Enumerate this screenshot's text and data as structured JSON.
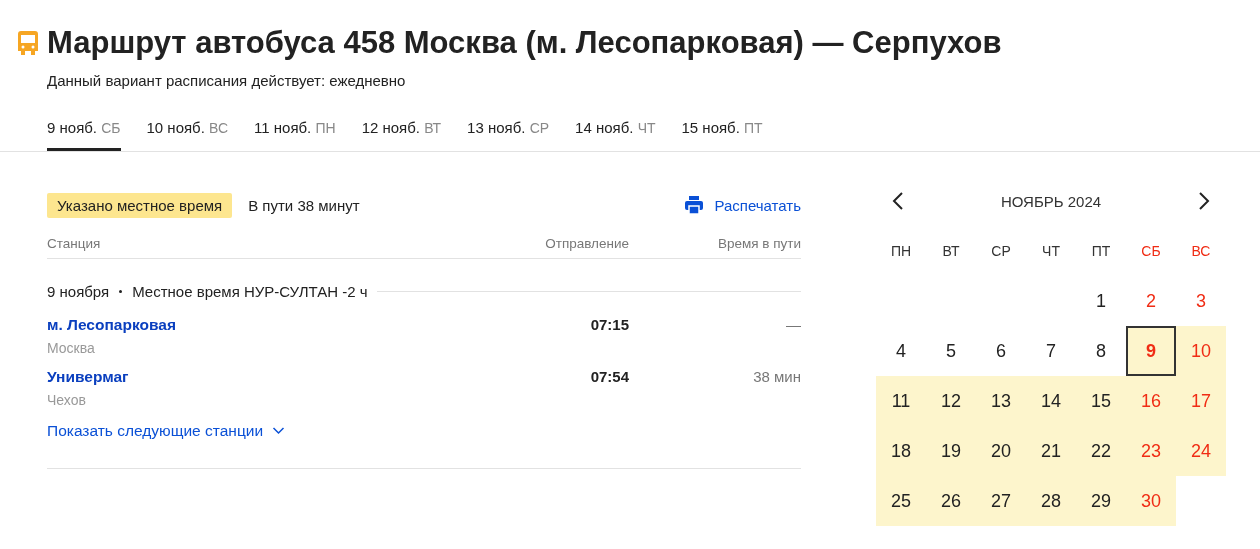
{
  "header": {
    "title": "Маршрут автобуса 458 Москва (м. Лесопарковая) — Серпухов",
    "subtitle": "Данный вариант расписания действует: ежедневно"
  },
  "date_tabs": [
    {
      "date": "9 нояб.",
      "weekday": "СБ",
      "selected": true
    },
    {
      "date": "10 нояб.",
      "weekday": "ВС",
      "selected": false
    },
    {
      "date": "11 нояб.",
      "weekday": "ПН",
      "selected": false
    },
    {
      "date": "12 нояб.",
      "weekday": "ВТ",
      "selected": false
    },
    {
      "date": "13 нояб.",
      "weekday": "СР",
      "selected": false
    },
    {
      "date": "14 нояб.",
      "weekday": "ЧТ",
      "selected": false
    },
    {
      "date": "15 нояб.",
      "weekday": "ПТ",
      "selected": false
    }
  ],
  "info": {
    "badge": "Указано местное время",
    "duration": "В пути 38 минут",
    "print_link": "Распечатать"
  },
  "table": {
    "columns": [
      "Станция",
      "Отправление",
      "Время в пути"
    ],
    "group": {
      "date": "9 ноября",
      "timezone": "Местное время НУР-СУЛТАН -2 ч"
    },
    "rows": [
      {
        "station": "м. Лесопарковая",
        "city": "Москва",
        "departure": "07:15",
        "travel_time": "—"
      },
      {
        "station": "Универмаг",
        "city": "Чехов",
        "departure": "07:54",
        "travel_time": "38 мин"
      }
    ],
    "show_more": "Показать следующие станции"
  },
  "calendar": {
    "month": "НОЯБРЬ 2024",
    "weekdays": [
      {
        "label": "ПН",
        "weekend": false
      },
      {
        "label": "ВТ",
        "weekend": false
      },
      {
        "label": "СР",
        "weekend": false
      },
      {
        "label": "ЧТ",
        "weekend": false
      },
      {
        "label": "ПТ",
        "weekend": false
      },
      {
        "label": "СБ",
        "weekend": true
      },
      {
        "label": "ВС",
        "weekend": true
      }
    ],
    "weeks": [
      [
        {
          "kind": "blank"
        },
        {
          "kind": "blank"
        },
        {
          "kind": "blank"
        },
        {
          "kind": "blank"
        },
        {
          "kind": "day",
          "day": "1",
          "weekend": false,
          "available": false,
          "selected": false
        },
        {
          "kind": "day",
          "day": "2",
          "weekend": true,
          "available": false,
          "selected": false
        },
        {
          "kind": "day",
          "day": "3",
          "weekend": true,
          "available": false,
          "selected": false
        }
      ],
      [
        {
          "kind": "day",
          "day": "4",
          "weekend": false,
          "available": false,
          "selected": false
        },
        {
          "kind": "day",
          "day": "5",
          "weekend": false,
          "available": false,
          "selected": false
        },
        {
          "kind": "day",
          "day": "6",
          "weekend": false,
          "available": false,
          "selected": false
        },
        {
          "kind": "day",
          "day": "7",
          "weekend": false,
          "available": false,
          "selected": false
        },
        {
          "kind": "day",
          "day": "8",
          "weekend": false,
          "available": false,
          "selected": false
        },
        {
          "kind": "day",
          "day": "9",
          "weekend": true,
          "available": true,
          "selected": true
        },
        {
          "kind": "day",
          "day": "10",
          "weekend": true,
          "available": true,
          "selected": false
        }
      ],
      [
        {
          "kind": "day",
          "day": "11",
          "weekend": false,
          "available": true,
          "selected": false
        },
        {
          "kind": "day",
          "day": "12",
          "weekend": false,
          "available": true,
          "selected": false
        },
        {
          "kind": "day",
          "day": "13",
          "weekend": false,
          "available": true,
          "selected": false
        },
        {
          "kind": "day",
          "day": "14",
          "weekend": false,
          "available": true,
          "selected": false
        },
        {
          "kind": "day",
          "day": "15",
          "weekend": false,
          "available": true,
          "selected": false
        },
        {
          "kind": "day",
          "day": "16",
          "weekend": true,
          "available": true,
          "selected": false
        },
        {
          "kind": "day",
          "day": "17",
          "weekend": true,
          "available": true,
          "selected": false
        }
      ],
      [
        {
          "kind": "day",
          "day": "18",
          "weekend": false,
          "available": true,
          "selected": false
        },
        {
          "kind": "day",
          "day": "19",
          "weekend": false,
          "available": true,
          "selected": false
        },
        {
          "kind": "day",
          "day": "20",
          "weekend": false,
          "available": true,
          "selected": false
        },
        {
          "kind": "day",
          "day": "21",
          "weekend": false,
          "available": true,
          "selected": false
        },
        {
          "kind": "day",
          "day": "22",
          "weekend": false,
          "available": true,
          "selected": false
        },
        {
          "kind": "day",
          "day": "23",
          "weekend": true,
          "available": true,
          "selected": false
        },
        {
          "kind": "day",
          "day": "24",
          "weekend": true,
          "available": true,
          "selected": false
        }
      ],
      [
        {
          "kind": "day",
          "day": "25",
          "weekend": false,
          "available": true,
          "selected": false
        },
        {
          "kind": "day",
          "day": "26",
          "weekend": false,
          "available": true,
          "selected": false
        },
        {
          "kind": "day",
          "day": "27",
          "weekend": false,
          "available": true,
          "selected": false
        },
        {
          "kind": "day",
          "day": "28",
          "weekend": false,
          "available": true,
          "selected": false
        },
        {
          "kind": "day",
          "day": "29",
          "weekend": false,
          "available": true,
          "selected": false
        },
        {
          "kind": "day",
          "day": "30",
          "weekend": true,
          "available": true,
          "selected": false
        },
        {
          "kind": "blank"
        }
      ]
    ]
  }
}
